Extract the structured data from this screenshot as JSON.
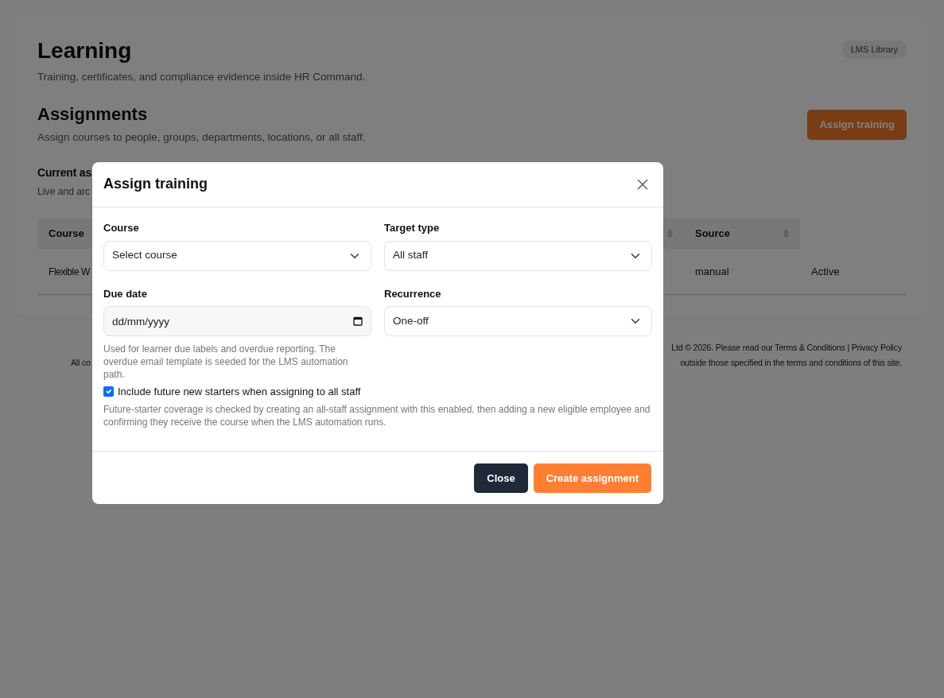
{
  "page": {
    "title": "Learning",
    "subtitle": "Training, certificates, and compliance evidence inside HR Command.",
    "badge": "LMS Library"
  },
  "section": {
    "title": "Assignments",
    "subtitle": "Assign courses to people, groups, departments, locations, or all staff.",
    "action": "Assign training"
  },
  "current": {
    "title": "Current as",
    "subtitle": "Live and arc"
  },
  "table": {
    "columns": [
      {
        "label": "Course"
      },
      {
        "sortable": true
      },
      {
        "label": "Source",
        "sortable": true
      },
      {
        "sortable": false
      }
    ],
    "rows": [
      {
        "cells": [
          "Flexible W",
          "",
          "manual",
          "Active"
        ]
      }
    ]
  },
  "footer": {
    "line_1": "Ltd © 2026. Please read our ",
    "terms_link": "Terms & Conditions",
    "separator": " | ",
    "privacy_link": "Privacy Policy",
    "line_2_start": "All co",
    "line_2_end": "outside those specified in the terms and conditions of this site."
  },
  "modal": {
    "title": "Assign training",
    "fields": [
      {
        "label": "Course",
        "kind": "select",
        "value": "Select course"
      },
      {
        "label": "Target type",
        "kind": "select",
        "value": "All staff"
      },
      {
        "label": "Due date",
        "kind": "date",
        "placeholder": "dd/mm/yyyy",
        "help": "Used for learner due labels and overdue reporting. The overdue email template is seeded for the LMS automation path."
      },
      {
        "label": "Recurrence",
        "kind": "select",
        "value": "One-off"
      }
    ],
    "option": {
      "label": "Include future new starters when assigning to all staff",
      "checked": true,
      "help": "Future-starter coverage is checked by creating an all-staff assignment with this enabled, then adding a new eligible employee and confirming they receive the course when the LMS automation runs."
    },
    "buttons": [
      {
        "label": "Close",
        "kind": "secondary"
      },
      {
        "label": "Create assignment",
        "kind": "primary"
      }
    ]
  }
}
